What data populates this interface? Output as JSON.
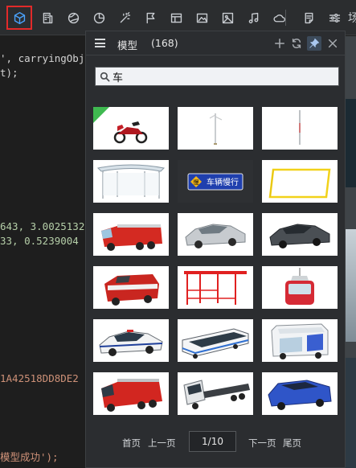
{
  "toolbar": {
    "items": [
      {
        "name": "model-cube-icon",
        "active": true
      },
      {
        "name": "building-icon"
      },
      {
        "name": "globe-icon"
      },
      {
        "name": "pie-chart-icon"
      },
      {
        "name": "magic-wand-icon"
      },
      {
        "name": "flag-icon"
      },
      {
        "name": "window-icon"
      },
      {
        "name": "image-icon"
      },
      {
        "name": "picture-icon"
      },
      {
        "name": "music-icon"
      },
      {
        "name": "cloud-icon"
      },
      {
        "name": "note-icon"
      },
      {
        "name": "sliders-icon"
      }
    ],
    "overflow_text": "场"
  },
  "editor": {
    "lines": [
      {
        "pre": "', carryingObj",
        "num": "",
        "str": ""
      },
      {
        "pre": "t);",
        "num": "",
        "str": ""
      },
      {
        "pre": "",
        "num": "643, 3.0025132",
        "str": ""
      },
      {
        "pre": "",
        "num": "33, 0.5239004",
        "str": ""
      },
      {
        "pre": "",
        "num": "",
        "str": "1A42518DD8DE2"
      },
      {
        "pre": "",
        "num": "",
        "str": "模型成功');"
      }
    ]
  },
  "panel": {
    "title": "模型",
    "count": "(168)",
    "search": {
      "value": "车",
      "placeholder": ""
    },
    "models": [
      {
        "name": "model-motorcycle",
        "badge": true
      },
      {
        "name": "model-street-lamp"
      },
      {
        "name": "model-flag-pole"
      },
      {
        "name": "model-glass-shelter"
      },
      {
        "name": "model-slow-sign",
        "sign_text": "车辆慢行",
        "sign_glyph": "慢"
      },
      {
        "name": "model-yellow-barrier"
      },
      {
        "name": "model-fire-truck"
      },
      {
        "name": "model-silver-sedan"
      },
      {
        "name": "model-dark-sedan"
      },
      {
        "name": "model-red-van"
      },
      {
        "name": "model-bus-stop"
      },
      {
        "name": "model-cable-car"
      },
      {
        "name": "model-police-car"
      },
      {
        "name": "model-bus"
      },
      {
        "name": "model-golf-cart"
      },
      {
        "name": "model-fire-truck-2"
      },
      {
        "name": "model-flatbed-truck"
      },
      {
        "name": "model-blue-car"
      }
    ],
    "pager": {
      "first": "首页",
      "prev": "上一页",
      "current": "1/10",
      "next": "下一页",
      "last": "尾页"
    }
  },
  "colors": {
    "accent": "#4aa3ff",
    "highlight_border": "#e22a2a",
    "panel_bg": "#2b2d30"
  }
}
